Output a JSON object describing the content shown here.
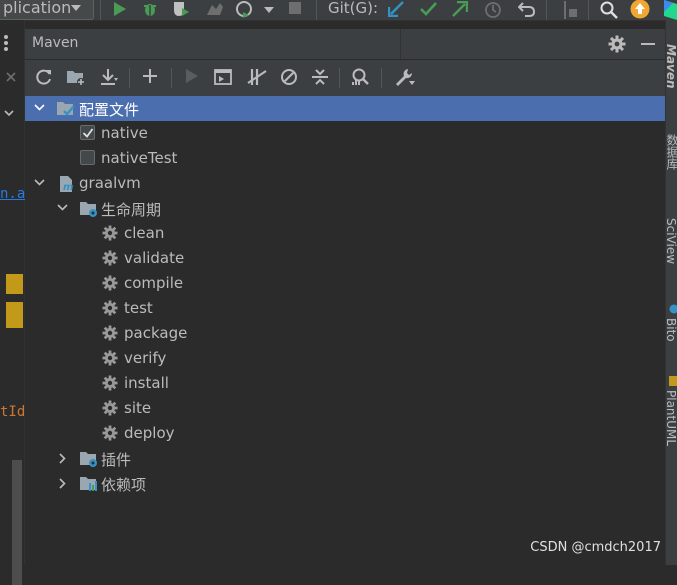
{
  "toolbar": {
    "run_config_label": "plication",
    "git_label": "Git(G):",
    "icons": [
      "chevron-down-icon",
      "run-icon",
      "debug-icon",
      "coverage-icon",
      "profile-icon",
      "run-with-icon",
      "chevron-down-icon",
      "stop-icon",
      "git-update-icon",
      "git-commit-icon",
      "git-push-icon",
      "history-icon",
      "rollback-icon",
      "branch-icon",
      "search-icon",
      "update-badge-icon",
      "jetbrains-icon"
    ]
  },
  "editor": {
    "fragments": [
      "n.a",
      "tId"
    ]
  },
  "maven": {
    "title": "Maven",
    "toolbar_icons": [
      "reload-icon",
      "add-folder-icon",
      "download-icon",
      "plus-icon",
      "run-icon",
      "execute-goal-icon",
      "toggle-offline-icon",
      "skip-tests-icon",
      "collapse-all-icon",
      "analyze-icon",
      "settings-wrench-icon"
    ],
    "tree": {
      "profiles": {
        "label": "配置文件",
        "items": [
          {
            "label": "native",
            "checked": true
          },
          {
            "label": "nativeTest",
            "checked": false
          }
        ]
      },
      "project": {
        "label": "graalvm",
        "lifecycle": {
          "label": "生命周期",
          "goals": [
            "clean",
            "validate",
            "compile",
            "test",
            "package",
            "verify",
            "install",
            "site",
            "deploy"
          ]
        },
        "plugins_label": "插件",
        "dependencies_label": "依赖项"
      }
    }
  },
  "right_stripe": {
    "tabs": [
      "Maven",
      "数据库",
      "SciView",
      "Bito",
      "PlantUML"
    ]
  },
  "watermark": "CSDN @cmdch2017",
  "colors": {
    "selection": "#4b6eaf",
    "background": "#2b2b2b",
    "panel": "#3c3f41",
    "run_green": "#499c54",
    "vcs_blue": "#3592c4",
    "update_orange": "#f0a732"
  }
}
